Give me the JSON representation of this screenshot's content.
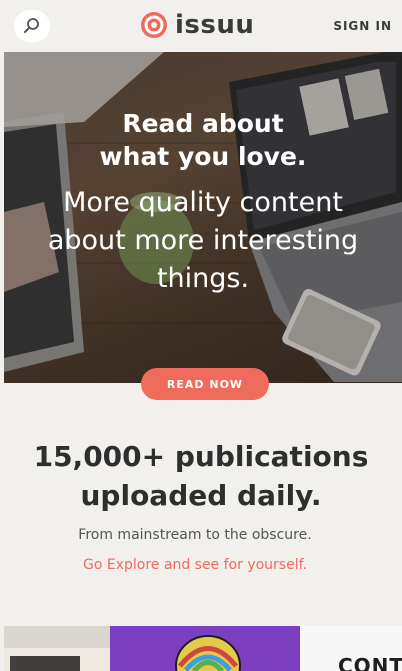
{
  "header": {
    "brand": "issuu",
    "signin_label": "SIGN IN"
  },
  "icons": {
    "search": "search-icon",
    "logo": "issuu-logo-icon"
  },
  "hero": {
    "title_line1": "Read about",
    "title_line2": "what you love.",
    "subtitle_line1": "More quality content",
    "subtitle_line2": "about more interesting",
    "subtitle_line3": "things.",
    "cta_label": "READ NOW"
  },
  "stats": {
    "title_line1": "15,000+ publications",
    "title_line2": "uploaded daily.",
    "subtitle": "From mainstream to the obscure.",
    "link": "Go Explore and see for yourself."
  },
  "strip": {
    "card_c_text": "CONT"
  },
  "colors": {
    "accent": "#ef6b5c",
    "background": "#f2f0ed",
    "text": "#2e2e2e"
  }
}
